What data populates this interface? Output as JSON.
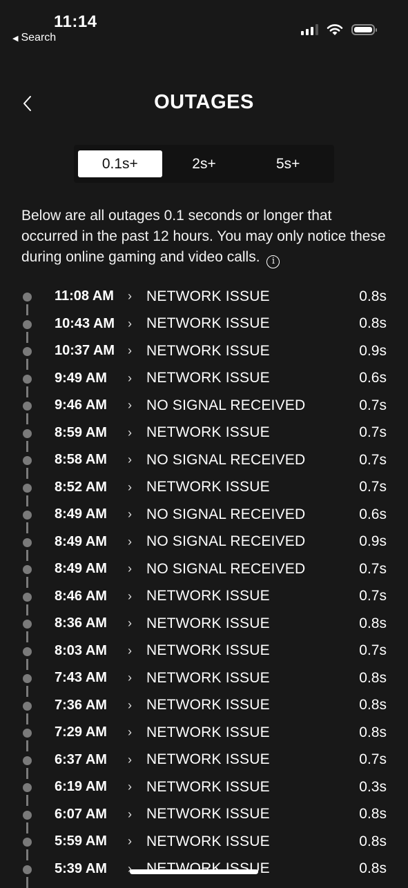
{
  "status_bar": {
    "time": "11:14",
    "back_app": "Search",
    "signal_bars": 3,
    "signal_bars_total": 4,
    "battery_level": 1.0
  },
  "header": {
    "title": "OUTAGES",
    "back_icon": "chevron-left-icon"
  },
  "filters": {
    "options": [
      "0.1s+",
      "2s+",
      "5s+"
    ],
    "selected": "0.1s+"
  },
  "description": {
    "text": "Below are all outages 0.1 seconds or longer that occurred in the past 12 hours. You may only notice these during online gaming and video calls.",
    "info_icon": "info-icon"
  },
  "outages": [
    {
      "time": "11:08 AM",
      "type": "NETWORK ISSUE",
      "duration": "0.8s"
    },
    {
      "time": "10:43 AM",
      "type": "NETWORK ISSUE",
      "duration": "0.8s"
    },
    {
      "time": "10:37 AM",
      "type": "NETWORK ISSUE",
      "duration": "0.9s"
    },
    {
      "time": "9:49 AM",
      "type": "NETWORK ISSUE",
      "duration": "0.6s"
    },
    {
      "time": "9:46 AM",
      "type": "NO SIGNAL RECEIVED",
      "duration": "0.7s"
    },
    {
      "time": "8:59 AM",
      "type": "NETWORK ISSUE",
      "duration": "0.7s"
    },
    {
      "time": "8:58 AM",
      "type": "NO SIGNAL RECEIVED",
      "duration": "0.7s"
    },
    {
      "time": "8:52 AM",
      "type": "NETWORK ISSUE",
      "duration": "0.7s"
    },
    {
      "time": "8:49 AM",
      "type": "NO SIGNAL RECEIVED",
      "duration": "0.6s"
    },
    {
      "time": "8:49 AM",
      "type": "NO SIGNAL RECEIVED",
      "duration": "0.9s"
    },
    {
      "time": "8:49 AM",
      "type": "NO SIGNAL RECEIVED",
      "duration": "0.7s"
    },
    {
      "time": "8:46 AM",
      "type": "NETWORK ISSUE",
      "duration": "0.7s"
    },
    {
      "time": "8:36 AM",
      "type": "NETWORK ISSUE",
      "duration": "0.8s"
    },
    {
      "time": "8:03 AM",
      "type": "NETWORK ISSUE",
      "duration": "0.7s"
    },
    {
      "time": "7:43 AM",
      "type": "NETWORK ISSUE",
      "duration": "0.8s"
    },
    {
      "time": "7:36 AM",
      "type": "NETWORK ISSUE",
      "duration": "0.8s"
    },
    {
      "time": "7:29 AM",
      "type": "NETWORK ISSUE",
      "duration": "0.8s"
    },
    {
      "time": "6:37 AM",
      "type": "NETWORK ISSUE",
      "duration": "0.7s"
    },
    {
      "time": "6:19 AM",
      "type": "NETWORK ISSUE",
      "duration": "0.3s"
    },
    {
      "time": "6:07 AM",
      "type": "NETWORK ISSUE",
      "duration": "0.8s"
    },
    {
      "time": "5:59 AM",
      "type": "NETWORK ISSUE",
      "duration": "0.8s"
    },
    {
      "time": "5:39 AM",
      "type": "NETWORK ISSUE",
      "duration": "0.8s"
    }
  ],
  "row_chevron": "chevron-right-icon",
  "colors": {
    "background": "#181818",
    "timeline": "#7a7a7a",
    "selected_tab_bg": "#ffffff"
  }
}
